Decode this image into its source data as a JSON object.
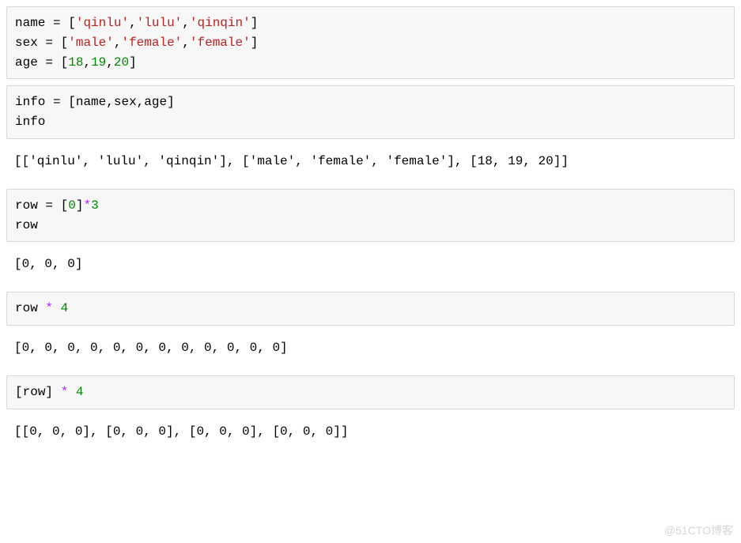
{
  "cells": [
    {
      "type": "code",
      "tokens": [
        {
          "t": "name",
          "c": "tok-var"
        },
        {
          "t": " ",
          "c": ""
        },
        {
          "t": "=",
          "c": "tok-op"
        },
        {
          "t": " ",
          "c": ""
        },
        {
          "t": "[",
          "c": "tok-br"
        },
        {
          "t": "'qinlu'",
          "c": "tok-str"
        },
        {
          "t": ",",
          "c": "tok-br"
        },
        {
          "t": "'lulu'",
          "c": "tok-str"
        },
        {
          "t": ",",
          "c": "tok-br"
        },
        {
          "t": "'qinqin'",
          "c": "tok-str"
        },
        {
          "t": "]",
          "c": "tok-br"
        },
        {
          "t": "\n",
          "c": ""
        },
        {
          "t": "sex",
          "c": "tok-var"
        },
        {
          "t": " ",
          "c": ""
        },
        {
          "t": "=",
          "c": "tok-op"
        },
        {
          "t": " ",
          "c": ""
        },
        {
          "t": "[",
          "c": "tok-br"
        },
        {
          "t": "'male'",
          "c": "tok-str"
        },
        {
          "t": ",",
          "c": "tok-br"
        },
        {
          "t": "'female'",
          "c": "tok-str"
        },
        {
          "t": ",",
          "c": "tok-br"
        },
        {
          "t": "'female'",
          "c": "tok-str"
        },
        {
          "t": "]",
          "c": "tok-br"
        },
        {
          "t": "\n",
          "c": ""
        },
        {
          "t": "age",
          "c": "tok-var"
        },
        {
          "t": " ",
          "c": ""
        },
        {
          "t": "=",
          "c": "tok-op"
        },
        {
          "t": " ",
          "c": ""
        },
        {
          "t": "[",
          "c": "tok-br"
        },
        {
          "t": "18",
          "c": "tok-num"
        },
        {
          "t": ",",
          "c": "tok-br"
        },
        {
          "t": "19",
          "c": "tok-num"
        },
        {
          "t": ",",
          "c": "tok-br"
        },
        {
          "t": "20",
          "c": "tok-num"
        },
        {
          "t": "]",
          "c": "tok-br"
        }
      ]
    },
    {
      "type": "code",
      "tokens": [
        {
          "t": "info",
          "c": "tok-var"
        },
        {
          "t": " ",
          "c": ""
        },
        {
          "t": "=",
          "c": "tok-op"
        },
        {
          "t": " ",
          "c": ""
        },
        {
          "t": "[",
          "c": "tok-br"
        },
        {
          "t": "name",
          "c": "tok-var"
        },
        {
          "t": ",",
          "c": "tok-br"
        },
        {
          "t": "sex",
          "c": "tok-var"
        },
        {
          "t": ",",
          "c": "tok-br"
        },
        {
          "t": "age",
          "c": "tok-var"
        },
        {
          "t": "]",
          "c": "tok-br"
        },
        {
          "t": "\n",
          "c": ""
        },
        {
          "t": "info",
          "c": "tok-var"
        }
      ]
    },
    {
      "type": "output",
      "text": "[['qinlu', 'lulu', 'qinqin'], ['male', 'female', 'female'], [18, 19, 20]]"
    },
    {
      "type": "code",
      "tokens": [
        {
          "t": "row",
          "c": "tok-var"
        },
        {
          "t": " ",
          "c": ""
        },
        {
          "t": "=",
          "c": "tok-op"
        },
        {
          "t": " ",
          "c": ""
        },
        {
          "t": "[",
          "c": "tok-br"
        },
        {
          "t": "0",
          "c": "tok-num"
        },
        {
          "t": "]",
          "c": "tok-br"
        },
        {
          "t": "*",
          "c": "tok-kw"
        },
        {
          "t": "3",
          "c": "tok-num"
        },
        {
          "t": "\n",
          "c": ""
        },
        {
          "t": "row",
          "c": "tok-var"
        }
      ]
    },
    {
      "type": "output",
      "text": "[0, 0, 0]"
    },
    {
      "type": "code",
      "tokens": [
        {
          "t": "row",
          "c": "tok-var"
        },
        {
          "t": " ",
          "c": ""
        },
        {
          "t": "*",
          "c": "tok-kw"
        },
        {
          "t": " ",
          "c": ""
        },
        {
          "t": "4",
          "c": "tok-num"
        }
      ]
    },
    {
      "type": "output",
      "text": "[0, 0, 0, 0, 0, 0, 0, 0, 0, 0, 0, 0]"
    },
    {
      "type": "code",
      "tokens": [
        {
          "t": "[",
          "c": "tok-br"
        },
        {
          "t": "row",
          "c": "tok-var"
        },
        {
          "t": "]",
          "c": "tok-br"
        },
        {
          "t": " ",
          "c": ""
        },
        {
          "t": "*",
          "c": "tok-kw"
        },
        {
          "t": " ",
          "c": ""
        },
        {
          "t": "4",
          "c": "tok-num"
        }
      ]
    },
    {
      "type": "output",
      "text": "[[0, 0, 0], [0, 0, 0], [0, 0, 0], [0, 0, 0]]"
    }
  ],
  "watermark": "@51CTO博客"
}
